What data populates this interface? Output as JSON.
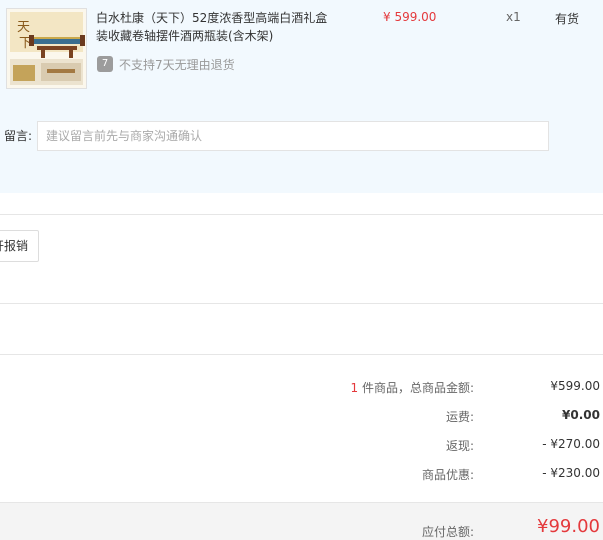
{
  "product": {
    "thumbnail_icon": "liquor-giftbox-image",
    "title": "白水杜康（天下）52度浓香型高端白酒礼盒装收藏卷轴摆件酒两瓶装(含木架)",
    "price": "¥ 599.00",
    "quantity": "x1",
    "stock": "有货",
    "return_icon_text": "7",
    "return_notice": "不支持7天无理由退货"
  },
  "memo": {
    "label": "留言:",
    "placeholder": "建议留言前先与商家沟通确认"
  },
  "invoice": {
    "button_label": "开报销"
  },
  "summary": {
    "count": "1",
    "count_suffix": " 件商品，总商品金额:",
    "goods_total": "¥599.00",
    "shipping_label": "运费:",
    "shipping": "¥0.00",
    "cashback_label": "返现:",
    "cashback": "- ¥270.00",
    "discount_label": "商品优惠:",
    "discount": "- ¥230.00"
  },
  "total": {
    "label": "应付总额:",
    "value": "¥99.00"
  },
  "colors": {
    "accent_red": "#e4393c",
    "panel_bg": "#f2f9fe"
  }
}
